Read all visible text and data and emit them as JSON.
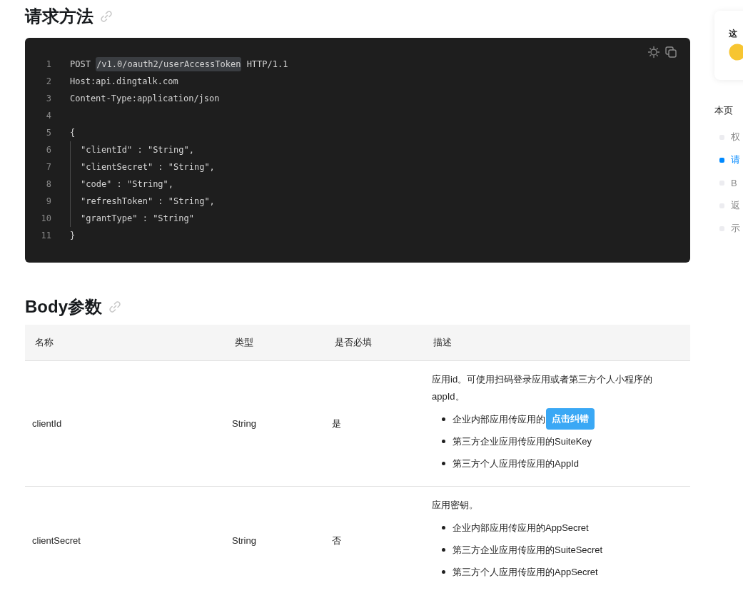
{
  "method_section": {
    "title": "请求方法",
    "code": [
      {
        "number": "1",
        "indented": false,
        "segments": [
          {
            "text": "POST ",
            "kind": "plain"
          },
          {
            "text": "/v1.0/oauth2/userAccessToken",
            "kind": "path"
          },
          {
            "text": " HTTP/1.1",
            "kind": "plain"
          }
        ]
      },
      {
        "number": "2",
        "indented": false,
        "segments": [
          {
            "text": "Host:api.dingtalk.com",
            "kind": "plain"
          }
        ]
      },
      {
        "number": "3",
        "indented": false,
        "segments": [
          {
            "text": "Content-Type:application/json",
            "kind": "plain"
          }
        ]
      },
      {
        "number": "4"
      },
      {
        "number": "5",
        "indented": false,
        "segments": [
          {
            "text": "{",
            "kind": "plain"
          }
        ]
      },
      {
        "number": "6",
        "indented": true,
        "segments": [
          {
            "text": "\"clientId\" : \"String\",",
            "kind": "plain"
          }
        ]
      },
      {
        "number": "7",
        "indented": true,
        "segments": [
          {
            "text": "\"clientSecret\" : \"String\",",
            "kind": "plain"
          }
        ]
      },
      {
        "number": "8",
        "indented": true,
        "segments": [
          {
            "text": "\"code\" : \"String\",",
            "kind": "plain"
          }
        ]
      },
      {
        "number": "9",
        "indented": true,
        "segments": [
          {
            "text": "\"refreshToken\" : \"String\",",
            "kind": "plain"
          }
        ]
      },
      {
        "number": "10",
        "indented": true,
        "segments": [
          {
            "text": "\"grantType\" : \"String\"",
            "kind": "plain"
          }
        ]
      },
      {
        "number": "11",
        "indented": false,
        "segments": [
          {
            "text": "}",
            "kind": "plain"
          }
        ]
      }
    ]
  },
  "body_section": {
    "title": "Body参数",
    "table": {
      "columns": [
        "名称",
        "类型",
        "是否必填",
        "描述"
      ],
      "rows": [
        {
          "name": "clientId",
          "type": "String",
          "required": "是",
          "description": "应用id。可使用扫码登录应用或者第三方个人小程序的appId。",
          "bullets": [
            "企业内部应用传应用的",
            "第三方企业应用传应用的SuiteKey",
            "第三方个人应用传应用的AppId"
          ]
        },
        {
          "name": "clientSecret",
          "type": "String",
          "required": "否",
          "description": "应用密钥。",
          "bullets": [
            "企业内部应用传应用的AppSecret",
            "第三方企业应用传应用的SuiteSecret",
            "第三方个人应用传应用的AppSecret"
          ]
        }
      ]
    }
  },
  "correction_tooltip": "点击纠错",
  "feedback_card": {
    "title": "这"
  },
  "toc": {
    "title": "本页",
    "items": [
      {
        "label": "权",
        "selected": false
      },
      {
        "label": "请",
        "selected": true
      },
      {
        "label": "B",
        "selected": false
      },
      {
        "label": "返",
        "selected": false
      },
      {
        "label": "示",
        "selected": false
      }
    ]
  }
}
